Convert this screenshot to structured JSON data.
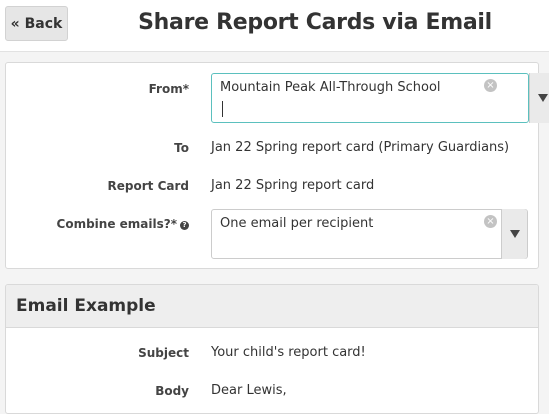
{
  "header": {
    "back_label": "« Back",
    "title": "Share Report Cards via Email"
  },
  "form": {
    "from_label": "From*",
    "from_value": "Mountain Peak All-Through School",
    "to_label": "To",
    "to_value": "Jan 22 Spring report card (Primary Guardians)",
    "report_card_label": "Report Card",
    "report_card_value": "Jan 22 Spring report card",
    "combine_label": "Combine emails?*",
    "combine_value": "One email per recipient"
  },
  "example": {
    "heading": "Email Example",
    "subject_label": "Subject",
    "subject_value": "Your child's report card!",
    "body_label": "Body",
    "body_value": "Dear Lewis,"
  }
}
